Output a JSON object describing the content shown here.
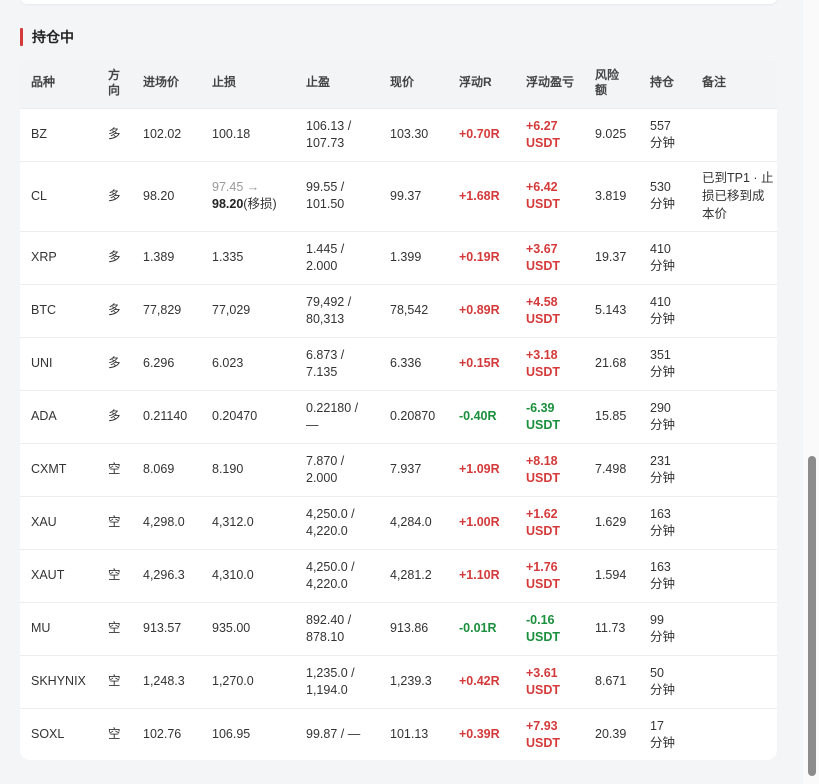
{
  "section": {
    "title": "持仓中",
    "accent_color": "#d43a3a"
  },
  "columns": [
    "品种",
    "方向",
    "进场价",
    "止损",
    "止盈",
    "现价",
    "浮动R",
    "浮动盈亏",
    "风险额",
    "持仓",
    "备注"
  ],
  "colors": {
    "profit": "#d43a3a",
    "loss": "#1a8f3c"
  },
  "rows": [
    {
      "symbol": "BZ",
      "side": "多",
      "entry": "102.02",
      "sl": "100.18",
      "tp1": "106.13 /",
      "tp2": "107.73",
      "price": "103.30",
      "r": "+0.70R",
      "r_sign": "pos",
      "pnl": "+6.27",
      "pnl_unit": "USDT",
      "pnl_sign": "pos",
      "risk": "9.025",
      "hold_num": "557",
      "hold_unit": "分钟",
      "note": ""
    },
    {
      "symbol": "CL",
      "side": "多",
      "entry": "98.20",
      "sl_old": "97.45 →",
      "sl_new": "98.20",
      "sl_note": "(移损)",
      "tp1": "99.55 /",
      "tp2": "101.50",
      "price": "99.37",
      "r": "+1.68R",
      "r_sign": "pos",
      "pnl": "+6.42",
      "pnl_unit": "USDT",
      "pnl_sign": "pos",
      "risk": "3.819",
      "hold_num": "530",
      "hold_unit": "分钟",
      "note": "已到TP1 · 止损已移到成本价"
    },
    {
      "symbol": "XRP",
      "side": "多",
      "entry": "1.389",
      "sl": "1.335",
      "tp1": "1.445 /",
      "tp2": "2.000",
      "price": "1.399",
      "r": "+0.19R",
      "r_sign": "pos",
      "pnl": "+3.67",
      "pnl_unit": "USDT",
      "pnl_sign": "pos",
      "risk": "19.37",
      "hold_num": "410",
      "hold_unit": "分钟",
      "note": ""
    },
    {
      "symbol": "BTC",
      "side": "多",
      "entry": "77,829",
      "sl": "77,029",
      "tp1": "79,492 /",
      "tp2": "80,313",
      "price": "78,542",
      "r": "+0.89R",
      "r_sign": "pos",
      "pnl": "+4.58",
      "pnl_unit": "USDT",
      "pnl_sign": "pos",
      "risk": "5.143",
      "hold_num": "410",
      "hold_unit": "分钟",
      "note": ""
    },
    {
      "symbol": "UNI",
      "side": "多",
      "entry": "6.296",
      "sl": "6.023",
      "tp1": "6.873 /",
      "tp2": "7.135",
      "price": "6.336",
      "r": "+0.15R",
      "r_sign": "pos",
      "pnl": "+3.18",
      "pnl_unit": "USDT",
      "pnl_sign": "pos",
      "risk": "21.68",
      "hold_num": "351",
      "hold_unit": "分钟",
      "note": ""
    },
    {
      "symbol": "ADA",
      "side": "多",
      "entry": "0.21140",
      "sl": "0.20470",
      "tp1": "0.22180 /",
      "tp2": "—",
      "price": "0.20870",
      "r": "-0.40R",
      "r_sign": "neg",
      "pnl": "-6.39",
      "pnl_unit": "USDT",
      "pnl_sign": "neg",
      "risk": "15.85",
      "hold_num": "290",
      "hold_unit": "分钟",
      "note": ""
    },
    {
      "symbol": "CXMT",
      "side": "空",
      "entry": "8.069",
      "sl": "8.190",
      "tp1": "7.870 /",
      "tp2": "2.000",
      "price": "7.937",
      "r": "+1.09R",
      "r_sign": "pos",
      "pnl": "+8.18",
      "pnl_unit": "USDT",
      "pnl_sign": "pos",
      "risk": "7.498",
      "hold_num": "231",
      "hold_unit": "分钟",
      "note": ""
    },
    {
      "symbol": "XAU",
      "side": "空",
      "entry": "4,298.0",
      "sl": "4,312.0",
      "tp1": "4,250.0 /",
      "tp2": "4,220.0",
      "price": "4,284.0",
      "r": "+1.00R",
      "r_sign": "pos",
      "pnl": "+1.62",
      "pnl_unit": "USDT",
      "pnl_sign": "pos",
      "risk": "1.629",
      "hold_num": "163",
      "hold_unit": "分钟",
      "note": ""
    },
    {
      "symbol": "XAUT",
      "side": "空",
      "entry": "4,296.3",
      "sl": "4,310.0",
      "tp1": "4,250.0 /",
      "tp2": "4,220.0",
      "price": "4,281.2",
      "r": "+1.10R",
      "r_sign": "pos",
      "pnl": "+1.76",
      "pnl_unit": "USDT",
      "pnl_sign": "pos",
      "risk": "1.594",
      "hold_num": "163",
      "hold_unit": "分钟",
      "note": ""
    },
    {
      "symbol": "MU",
      "side": "空",
      "entry": "913.57",
      "sl": "935.00",
      "tp1": "892.40 /",
      "tp2": "878.10",
      "price": "913.86",
      "r": "-0.01R",
      "r_sign": "neg",
      "pnl": "-0.16",
      "pnl_unit": "USDT",
      "pnl_sign": "neg",
      "risk": "11.73",
      "hold_num": "99",
      "hold_unit": "分钟",
      "note": ""
    },
    {
      "symbol": "SKHYNIX",
      "side": "空",
      "entry": "1,248.3",
      "sl": "1,270.0",
      "tp1": "1,235.0 /",
      "tp2": "1,194.0",
      "price": "1,239.3",
      "r": "+0.42R",
      "r_sign": "pos",
      "pnl": "+3.61",
      "pnl_unit": "USDT",
      "pnl_sign": "pos",
      "risk": "8.671",
      "hold_num": "50",
      "hold_unit": "分钟",
      "note": ""
    },
    {
      "symbol": "SOXL",
      "side": "空",
      "entry": "102.76",
      "sl": "106.95",
      "tp1": "99.87 / —",
      "tp2": "",
      "price": "101.13",
      "r": "+0.39R",
      "r_sign": "pos",
      "pnl": "+7.93",
      "pnl_unit": "USDT",
      "pnl_sign": "pos",
      "risk": "20.39",
      "hold_num": "17",
      "hold_unit": "分钟",
      "note": ""
    }
  ]
}
